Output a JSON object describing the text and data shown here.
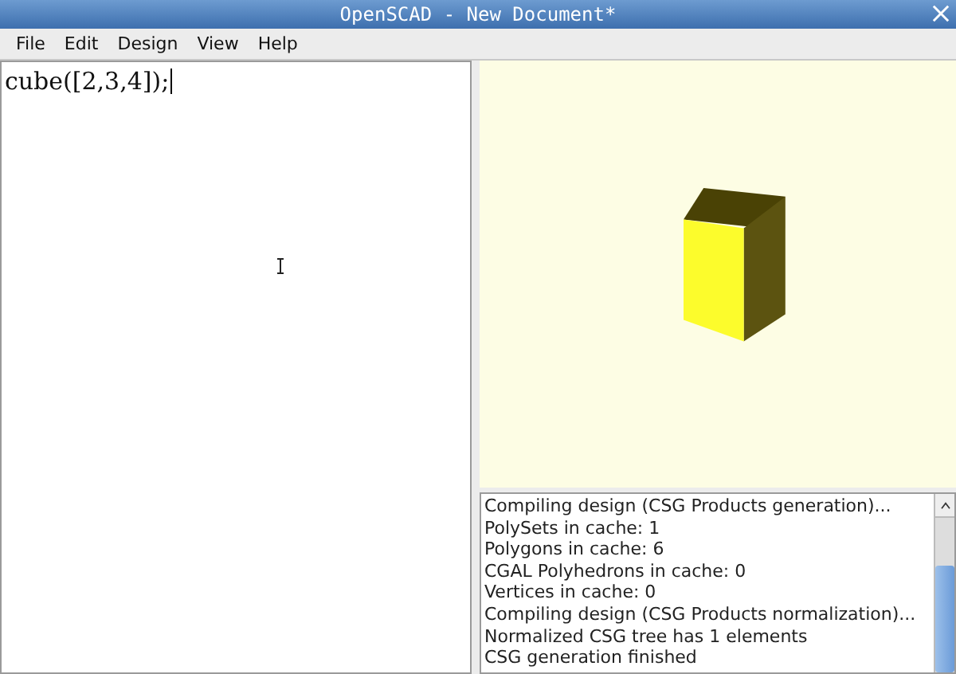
{
  "window": {
    "title": "OpenSCAD - New Document*"
  },
  "menu": [
    "File",
    "Edit",
    "Design",
    "View",
    "Help"
  ],
  "editor": {
    "value": "cube([2,3,4]);"
  },
  "console": {
    "lines": [
      "Compiling design (CSG Products generation)...",
      "PolySets in cache: 1",
      "Polygons in cache: 6",
      "CGAL Polyhedrons in cache: 0",
      "Vertices in cache: 0",
      "Compiling design (CSG Products normalization)...",
      "Normalized CSG tree has 1 elements",
      "CSG generation finished"
    ]
  }
}
